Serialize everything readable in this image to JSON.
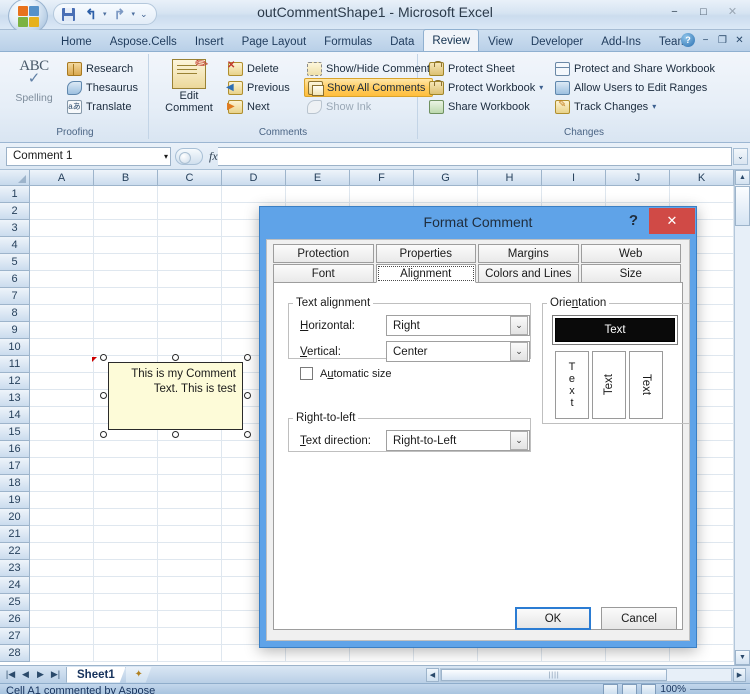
{
  "window": {
    "title": "outCommentShape1 - Microsoft Excel",
    "minimize": "−",
    "maximize": "□",
    "close": "✕"
  },
  "quick_access": {
    "save_icon": "save-icon",
    "undo_icon": "undo-icon",
    "redo_icon": "redo-icon",
    "customize_icon": "customize-qat-icon",
    "undo_glyph": "↰",
    "redo_glyph": "↱",
    "caret": "▾",
    "more_glyph": "⌄"
  },
  "ribbon": {
    "tabs": [
      {
        "label": "Home",
        "active": false
      },
      {
        "label": "Aspose.Cells",
        "active": false
      },
      {
        "label": "Insert",
        "active": false
      },
      {
        "label": "Page Layout",
        "active": false
      },
      {
        "label": "Formulas",
        "active": false
      },
      {
        "label": "Data",
        "active": false
      },
      {
        "label": "Review",
        "active": true
      },
      {
        "label": "View",
        "active": false
      },
      {
        "label": "Developer",
        "active": false
      },
      {
        "label": "Add-Ins",
        "active": false
      },
      {
        "label": "Team",
        "active": false
      }
    ],
    "help_glyph": "?",
    "minimize_ribbon": "−",
    "restore_glyph": "❐",
    "close_glyph": "✕",
    "groups": [
      {
        "name": "Proofing",
        "big_button": {
          "label": "Spelling",
          "abc": "ABC",
          "check": "✓"
        },
        "items": [
          {
            "label": "Research",
            "icon": "research-book-icon"
          },
          {
            "label": "Thesaurus",
            "icon": "thesaurus-icon"
          },
          {
            "label": "Translate",
            "icon": "translate-icon",
            "glyph": "aあ"
          }
        ]
      },
      {
        "name": "Comments",
        "big_button": {
          "label_line1": "Edit",
          "label_line2": "Comment",
          "icon": "edit-comment-icon"
        },
        "items": [
          {
            "label": "Delete",
            "icon": "delete-comment-icon",
            "state": "normal"
          },
          {
            "label": "Previous",
            "icon": "previous-comment-icon",
            "state": "normal"
          },
          {
            "label": "Next",
            "icon": "next-comment-icon",
            "state": "normal"
          },
          {
            "label": "Show/Hide Comment",
            "icon": "show-hide-comment-icon",
            "state": "normal"
          },
          {
            "label": "Show All Comments",
            "icon": "show-all-comments-icon",
            "state": "toggled-on"
          },
          {
            "label": "Show Ink",
            "icon": "show-ink-icon",
            "state": "disabled"
          }
        ]
      },
      {
        "name": "Changes",
        "items": [
          {
            "label": "Protect Sheet",
            "icon": "protect-sheet-icon",
            "dropdown": false
          },
          {
            "label": "Protect Workbook",
            "icon": "protect-workbook-icon",
            "dropdown": true
          },
          {
            "label": "Share Workbook",
            "icon": "share-workbook-icon",
            "dropdown": false
          },
          {
            "label": "Protect and Share Workbook",
            "icon": "protect-share-workbook-icon",
            "dropdown": false
          },
          {
            "label": "Allow Users to Edit Ranges",
            "icon": "allow-users-edit-ranges-icon",
            "dropdown": false
          },
          {
            "label": "Track Changes",
            "icon": "track-changes-icon",
            "dropdown": true
          }
        ]
      }
    ]
  },
  "formula_bar": {
    "name_box_value": "Comment 1",
    "name_box_caret": "▾",
    "fx_label": "fx",
    "formula_value": "",
    "expand_caret": "⌄"
  },
  "grid": {
    "columns": [
      "A",
      "B",
      "C",
      "D",
      "E",
      "F",
      "G",
      "H",
      "I",
      "J",
      "K"
    ],
    "rows": [
      1,
      2,
      3,
      4,
      5,
      6,
      7,
      8,
      9,
      10,
      11,
      12,
      13,
      14,
      15,
      16,
      17,
      18,
      19,
      20,
      21,
      22,
      23,
      24,
      25,
      26,
      27,
      28
    ],
    "comment_shape": {
      "text": "This is my Comment Text. This is test",
      "align": "right",
      "background": "#fdfbd8"
    }
  },
  "dialog": {
    "title": "Format Comment",
    "help_glyph": "?",
    "close_glyph": "✕",
    "tabs_row1": [
      {
        "label": "Protection",
        "selected": false
      },
      {
        "label": "Properties",
        "selected": false
      },
      {
        "label": "Margins",
        "selected": false
      },
      {
        "label": "Web",
        "selected": false
      }
    ],
    "tabs_row2": [
      {
        "label": "Font",
        "selected": false
      },
      {
        "label": "Alignment",
        "selected": true
      },
      {
        "label": "Colors and Lines",
        "selected": false
      },
      {
        "label": "Size",
        "selected": false
      }
    ],
    "text_alignment": {
      "legend": "Text alignment",
      "horizontal_label": "Horizontal:",
      "horizontal_value": "Right",
      "vertical_label": "Vertical:",
      "vertical_value": "Center",
      "automatic_size_label": "Automatic size",
      "automatic_size_checked": false,
      "caret": "⌄"
    },
    "right_to_left": {
      "legend": "Right-to-left",
      "text_direction_label": "Text direction:",
      "text_direction_value": "Right-to-Left",
      "caret": "⌄"
    },
    "orientation": {
      "legend": "Orientation",
      "horizontal_sample": "Text",
      "stacked_sample": "Text",
      "rotate_up_sample": "Text",
      "rotate_down_sample": "Text",
      "selected": "horizontal"
    },
    "buttons": {
      "ok": "OK",
      "cancel": "Cancel"
    }
  },
  "sheet_bar": {
    "nav_first": "|◀",
    "nav_prev": "◀",
    "nav_next": "▶",
    "nav_last": "▶|",
    "tabs": [
      {
        "label": "Sheet1",
        "active": true
      }
    ],
    "insert_sheet_icon": "insert-worksheet-icon",
    "scroll_left": "◀",
    "scroll_right": "▶",
    "thumb_grip": "||||"
  },
  "status_bar": {
    "text": "Cell A1 commented by Aspose",
    "zoom": "100%",
    "view_normal_icon": "normal-view-icon",
    "view_layout_icon": "page-layout-view-icon",
    "view_break_icon": "page-break-view-icon",
    "zoom_out": "−",
    "zoom_in": "+"
  }
}
